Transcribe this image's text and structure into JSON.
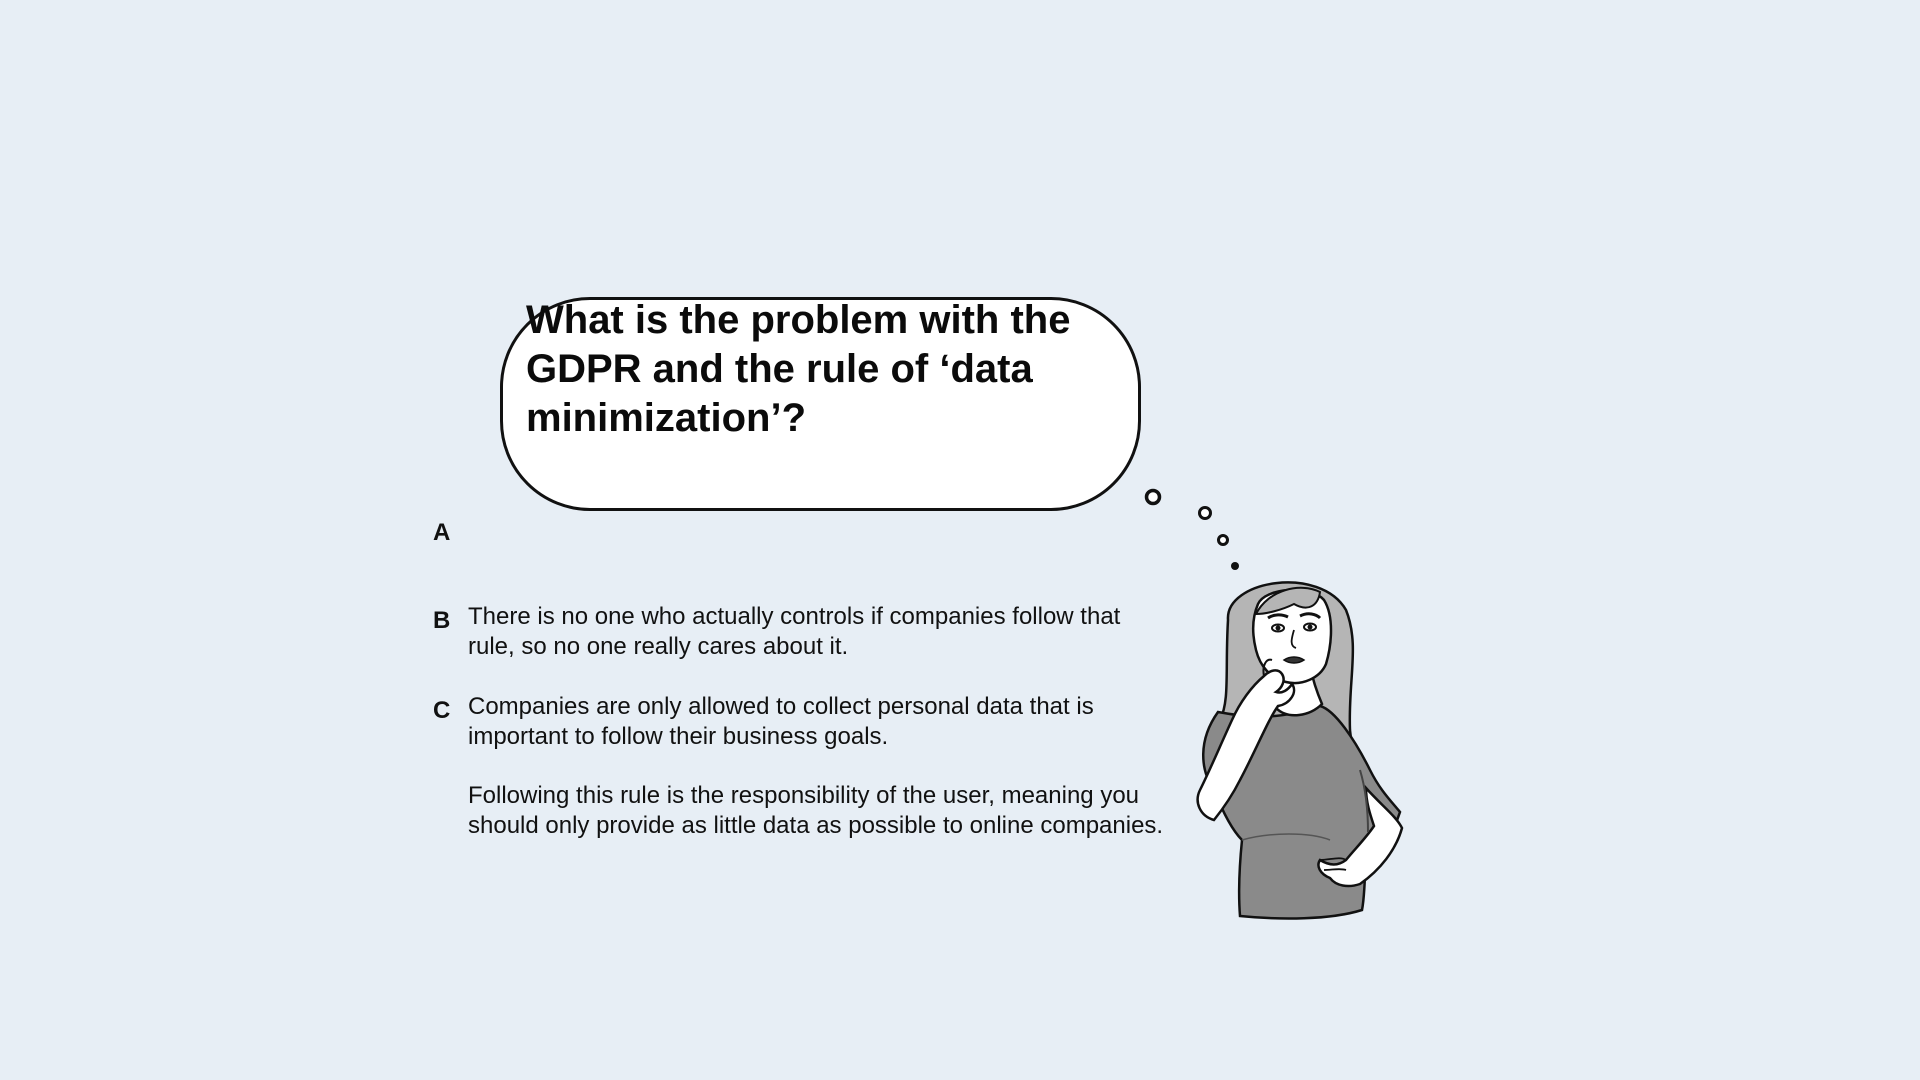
{
  "question": {
    "text": "What is the problem with the GDPR and the rule of ‘data minimization’?"
  },
  "options": [
    {
      "letter": "A",
      "text": ""
    },
    {
      "letter": "B",
      "text": "There is no one who actually controls if companies follow that rule, so no one really cares about it."
    },
    {
      "letter": "C",
      "text": "Companies are only allowed to collect personal data that is important to follow their business goals."
    },
    {
      "letter": "",
      "text": "Following this rule is the responsibility of the user, meaning you should only provide as little data as possible to online companies."
    }
  ],
  "illustration": {
    "icon": "thinking-woman-illustration",
    "bubble_icon": "thought-bubble-icon"
  },
  "colors": {
    "background": "#e7eef5",
    "bubble_fill": "#ffffff",
    "outline": "#111111",
    "shirt": "#8a8a8a",
    "hair": "#b5b5b5"
  }
}
